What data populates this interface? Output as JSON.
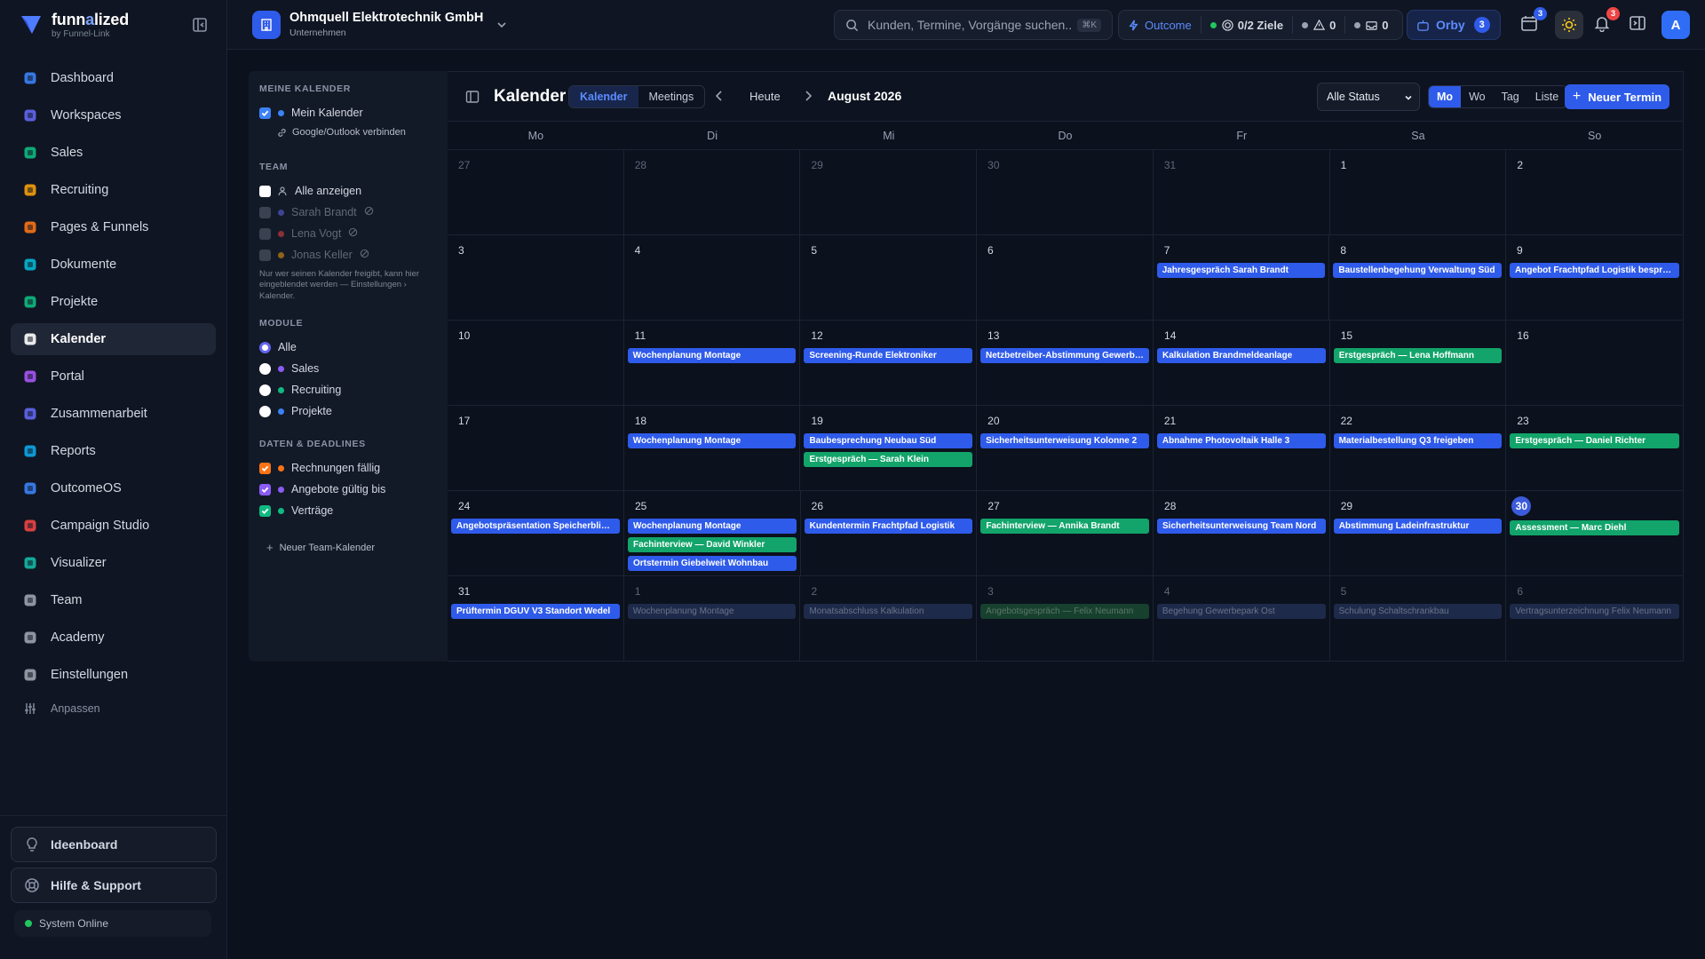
{
  "brand": {
    "name_part1": "funn",
    "name_hl": "a",
    "name_part2": "lized",
    "sub": "by Funnel-Link"
  },
  "nav": [
    {
      "label": "Dashboard",
      "icon": "dashboard-icon",
      "color": "#3b82f6"
    },
    {
      "label": "Workspaces",
      "icon": "workspaces-icon",
      "color": "#6366f1"
    },
    {
      "label": "Sales",
      "icon": "sales-icon",
      "color": "#10b981"
    },
    {
      "label": "Recruiting",
      "icon": "recruiting-icon",
      "color": "#f59e0b"
    },
    {
      "label": "Pages & Funnels",
      "icon": "funnel-icon",
      "color": "#f97316"
    },
    {
      "label": "Dokumente",
      "icon": "document-icon",
      "color": "#06b6d4"
    },
    {
      "label": "Projekte",
      "icon": "projects-icon",
      "color": "#10b981"
    },
    {
      "label": "Kalender",
      "icon": "calendar-icon",
      "color": "#ffffff",
      "active": true
    },
    {
      "label": "Portal",
      "icon": "portal-icon",
      "color": "#a855f7"
    },
    {
      "label": "Zusammenarbeit",
      "icon": "collaboration-icon",
      "color": "#6366f1"
    },
    {
      "label": "Reports",
      "icon": "reports-icon",
      "color": "#0ea5e9"
    },
    {
      "label": "OutcomeOS",
      "icon": "outcome-icon",
      "color": "#3b82f6"
    },
    {
      "label": "Campaign Studio",
      "icon": "campaign-icon",
      "color": "#ef4444"
    },
    {
      "label": "Visualizer",
      "icon": "visualizer-icon",
      "color": "#14b8a6"
    },
    {
      "label": "Team",
      "icon": "team-icon",
      "color": "#9ca3af"
    },
    {
      "label": "Academy",
      "icon": "academy-icon",
      "color": "#9ca3af"
    },
    {
      "label": "Einstellungen",
      "icon": "settings-icon",
      "color": "#9ca3af"
    }
  ],
  "nav_customize": "Anpassen",
  "sidebar_bottom": {
    "ideas": "Ideenboard",
    "help": "Hilfe & Support",
    "status": "System Online"
  },
  "topbar": {
    "company": "Ohmquell Elektrotechnik GmbH",
    "company_type": "Unternehmen",
    "search_placeholder": "Kunden, Termine, Vorgänge suchen...",
    "search_kbd": "⌘K",
    "outcome": "Outcome",
    "goals": "0/2 Ziele",
    "alerts": "0",
    "messages": "0",
    "orby": "Orby",
    "orby_count": "3",
    "calendar_badge": "3",
    "notif_badge": "3",
    "avatar": "A"
  },
  "panel": {
    "my_calendars": "MEINE KALENDER",
    "my_calendar": "Mein Kalender",
    "connect": "Google/Outlook verbinden",
    "team": "TEAM",
    "show_all": "Alle anzeigen",
    "members": [
      {
        "name": "Sarah Brandt",
        "color": "#6366f1"
      },
      {
        "name": "Lena Vogt",
        "color": "#ef4444"
      },
      {
        "name": "Jonas Keller",
        "color": "#f59e0b"
      }
    ],
    "hint": "Nur wer seinen Kalender freigibt, kann hier eingeblendet werden — Einstellungen › Kalender.",
    "modules": "MODULE",
    "module_items": [
      {
        "label": "Alle",
        "color": ""
      },
      {
        "label": "Sales",
        "color": "#8b5cf6"
      },
      {
        "label": "Recruiting",
        "color": "#10b981"
      },
      {
        "label": "Projekte",
        "color": "#3b82f6"
      }
    ],
    "deadlines": "DATEN & DEADLINES",
    "deadline_items": [
      {
        "label": "Rechnungen fällig",
        "color": "#f97316"
      },
      {
        "label": "Angebote gültig bis",
        "color": "#8b5cf6"
      },
      {
        "label": "Verträge",
        "color": "#10b981"
      }
    ],
    "new_team_cal": "Neuer Team-Kalender"
  },
  "calendar": {
    "title": "Kalender",
    "tabs": [
      "Kalender",
      "Meetings"
    ],
    "today": "Heute",
    "month": "August 2026",
    "status": "Alle Status",
    "views": [
      "Mo",
      "Wo",
      "Tag",
      "Liste"
    ],
    "new_event": "Neuer Termin",
    "weekdays": [
      "Mo",
      "Di",
      "Mi",
      "Do",
      "Fr",
      "Sa",
      "So"
    ],
    "weeks": [
      [
        {
          "d": "27",
          "o": true,
          "e": []
        },
        {
          "d": "28",
          "o": true,
          "e": []
        },
        {
          "d": "29",
          "o": true,
          "e": []
        },
        {
          "d": "30",
          "o": true,
          "e": []
        },
        {
          "d": "31",
          "o": true,
          "e": []
        },
        {
          "d": "1",
          "e": []
        },
        {
          "d": "2",
          "e": []
        }
      ],
      [
        {
          "d": "3",
          "e": []
        },
        {
          "d": "4",
          "e": []
        },
        {
          "d": "5",
          "e": []
        },
        {
          "d": "6",
          "e": []
        },
        {
          "d": "7",
          "e": [
            {
              "t": "Jahresgespräch Sarah Brandt",
              "c": "blue"
            }
          ]
        },
        {
          "d": "8",
          "e": [
            {
              "t": "Baustellenbegehung Verwaltung Süd",
              "c": "blue"
            }
          ]
        },
        {
          "d": "9",
          "e": [
            {
              "t": "Angebot Frachtpfad Logistik besprech...",
              "c": "blue"
            }
          ]
        }
      ],
      [
        {
          "d": "10",
          "e": []
        },
        {
          "d": "11",
          "e": [
            {
              "t": "Wochenplanung Montage",
              "c": "blue"
            }
          ]
        },
        {
          "d": "12",
          "e": [
            {
              "t": "Screening-Runde Elektroniker",
              "c": "blue"
            }
          ]
        },
        {
          "d": "13",
          "e": [
            {
              "t": "Netzbetreiber-Abstimmung Gewerbep...",
              "c": "blue"
            }
          ]
        },
        {
          "d": "14",
          "e": [
            {
              "t": "Kalkulation Brandmeldeanlage",
              "c": "blue"
            }
          ]
        },
        {
          "d": "15",
          "e": [
            {
              "t": "Erstgespräch — Lena Hoffmann",
              "c": "green"
            }
          ]
        },
        {
          "d": "16",
          "e": []
        }
      ],
      [
        {
          "d": "17",
          "e": []
        },
        {
          "d": "18",
          "e": [
            {
              "t": "Wochenplanung Montage",
              "c": "blue"
            }
          ]
        },
        {
          "d": "19",
          "e": [
            {
              "t": "Baubesprechung Neubau Süd",
              "c": "blue"
            },
            {
              "t": "Erstgespräch — Sarah Klein",
              "c": "green"
            }
          ]
        },
        {
          "d": "20",
          "e": [
            {
              "t": "Sicherheitsunterweisung Kolonne 2",
              "c": "blue"
            }
          ]
        },
        {
          "d": "21",
          "e": [
            {
              "t": "Abnahme Photovoltaik Halle 3",
              "c": "blue"
            }
          ]
        },
        {
          "d": "22",
          "e": [
            {
              "t": "Materialbestellung Q3 freigeben",
              "c": "blue"
            }
          ]
        },
        {
          "d": "23",
          "e": [
            {
              "t": "Erstgespräch — Daniel Richter",
              "c": "green"
            }
          ]
        }
      ],
      [
        {
          "d": "24",
          "e": [
            {
              "t": "Angebotspräsentation Speicherblick H...",
              "c": "blue"
            }
          ]
        },
        {
          "d": "25",
          "e": [
            {
              "t": "Wochenplanung Montage",
              "c": "blue"
            },
            {
              "t": "Fachinterview — David Winkler",
              "c": "green"
            },
            {
              "t": "Ortstermin Giebelweit Wohnbau",
              "c": "blue"
            }
          ]
        },
        {
          "d": "26",
          "e": [
            {
              "t": "Kundentermin Frachtpfad Logistik",
              "c": "blue"
            }
          ]
        },
        {
          "d": "27",
          "e": [
            {
              "t": "Fachinterview — Annika Brandt",
              "c": "green"
            }
          ]
        },
        {
          "d": "28",
          "e": [
            {
              "t": "Sicherheitsunterweisung Team Nord",
              "c": "blue"
            }
          ]
        },
        {
          "d": "29",
          "e": [
            {
              "t": "Abstimmung Ladeinfrastruktur",
              "c": "blue"
            }
          ]
        },
        {
          "d": "30",
          "today": true,
          "e": [
            {
              "t": "Assessment — Marc Diehl",
              "c": "green"
            }
          ]
        }
      ],
      [
        {
          "d": "31",
          "e": [
            {
              "t": "Prüftermin DGUV V3 Standort Wedel",
              "c": "blue"
            }
          ]
        },
        {
          "d": "1",
          "o": true,
          "e": [
            {
              "t": "Wochenplanung Montage",
              "c": "blue"
            }
          ]
        },
        {
          "d": "2",
          "o": true,
          "e": [
            {
              "t": "Monatsabschluss Kalkulation",
              "c": "blue"
            }
          ]
        },
        {
          "d": "3",
          "o": true,
          "e": [
            {
              "t": "Angebotsgespräch — Felix Neumann",
              "c": "green"
            }
          ]
        },
        {
          "d": "4",
          "o": true,
          "e": [
            {
              "t": "Begehung Gewerbepark Ost",
              "c": "blue"
            }
          ]
        },
        {
          "d": "5",
          "o": true,
          "e": [
            {
              "t": "Schulung Schaltschrankbau",
              "c": "blue"
            }
          ]
        },
        {
          "d": "6",
          "o": true,
          "e": [
            {
              "t": "Vertragsunterzeichnung Felix Neumann",
              "c": "blue"
            }
          ]
        }
      ]
    ]
  }
}
